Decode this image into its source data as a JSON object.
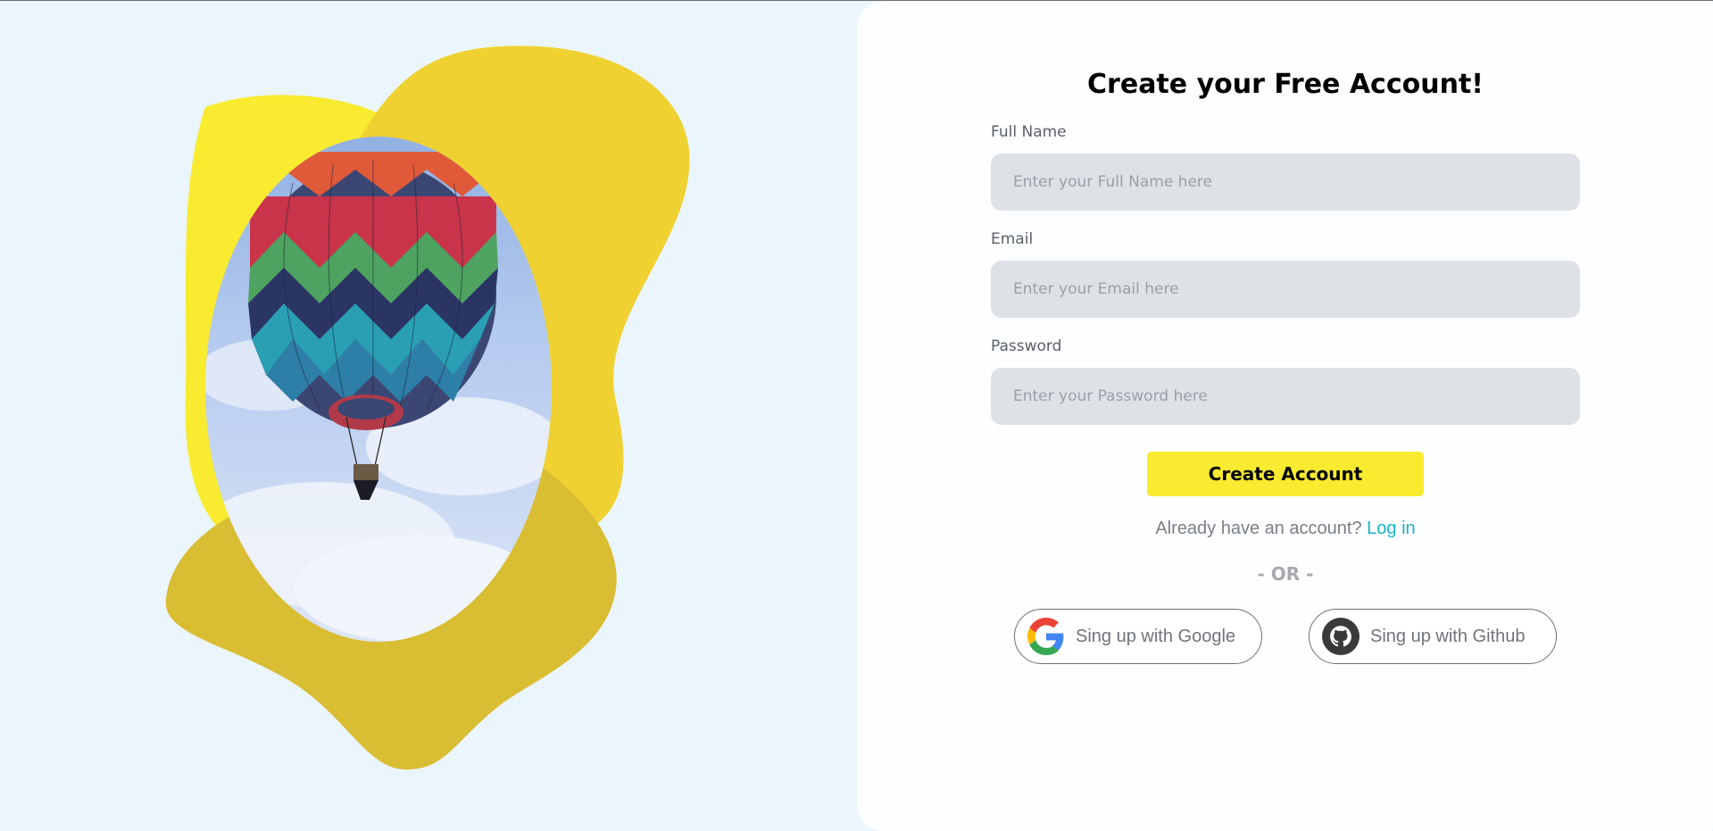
{
  "form": {
    "title": "Create your Free Account!",
    "fields": [
      {
        "label": "Full Name",
        "placeholder": "Enter your Full Name here",
        "value": ""
      },
      {
        "label": "Email",
        "placeholder": "Enter your Email here",
        "value": ""
      },
      {
        "label": "Password",
        "placeholder": "Enter your Password here",
        "value": ""
      }
    ],
    "submit_label": "Create Account",
    "login_prompt": "Already have an account?",
    "login_link": "Log in",
    "divider": "- OR -",
    "google_label": "Sing up with Google",
    "github_label": "Sing up with Github"
  },
  "illustration": {
    "subject": "hot-air-balloon",
    "blob_colors": [
      "#f8eb30",
      "#efd232",
      "#d9bd33"
    ]
  },
  "colors": {
    "accent": "#f8eb30",
    "link": "#17b3c8",
    "input_bg": "#dee2e6",
    "card_bg": "#fdfeff",
    "page_bg": "#ebf5fc"
  }
}
